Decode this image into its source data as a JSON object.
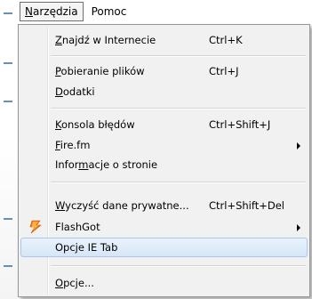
{
  "menubar": {
    "items": [
      {
        "label": "Narzędzia",
        "underline": "N",
        "rest": "arzędzia",
        "active": true
      },
      {
        "label": "Pomoc",
        "underline": "",
        "rest": "Pomoc",
        "active": false
      }
    ]
  },
  "menu": {
    "items": [
      {
        "pre": "",
        "u": "Z",
        "post": "najdź w Internecie",
        "shortcut": "Ctrl+K",
        "submenu": false
      },
      {
        "pre": "",
        "u": "P",
        "post": "obieranie plików",
        "shortcut": "Ctrl+J",
        "submenu": false
      },
      {
        "pre": "",
        "u": "D",
        "post": "odatki",
        "shortcut": "",
        "submenu": false
      },
      {
        "pre": "",
        "u": "K",
        "post": "onsola błędów",
        "shortcut": "Ctrl+Shift+J",
        "submenu": false
      },
      {
        "pre": "",
        "u": "F",
        "post": "ire.fm",
        "shortcut": "",
        "submenu": true
      },
      {
        "pre": "Infor",
        "u": "m",
        "post": "acje o stronie",
        "shortcut": "",
        "submenu": false
      },
      {
        "pre": "",
        "u": "W",
        "post": "yczyść dane prywatne...",
        "shortcut": "Ctrl+Shift+Del",
        "submenu": false
      },
      {
        "pre": "FlashGot",
        "u": "",
        "post": "",
        "shortcut": "",
        "submenu": true,
        "icon": "flashgot-icon"
      },
      {
        "pre": "Opcje IE Tab",
        "u": "",
        "post": "",
        "shortcut": "",
        "submenu": false,
        "highlighted": true
      },
      {
        "pre": "",
        "u": "O",
        "post": "pcje...",
        "shortcut": "",
        "submenu": false
      }
    ]
  },
  "colors": {
    "highlight": "#d6e6f7",
    "menu_bg": "#f1f1f1",
    "flashgot_orange": "#f07a10"
  }
}
